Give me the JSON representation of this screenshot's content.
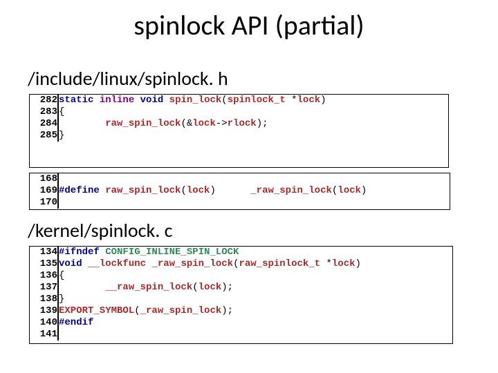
{
  "title": "spinlock API (partial)",
  "paths": {
    "header": "/include/linux/spinlock. h",
    "source": "/kernel/spinlock. c"
  },
  "block1": {
    "lines": [
      {
        "ln": "282",
        "segs": [
          {
            "c": "kw2",
            "t": "static"
          },
          {
            "c": "plain",
            "t": " "
          },
          {
            "c": "kw",
            "t": "inline"
          },
          {
            "c": "plain",
            "t": " "
          },
          {
            "c": "kw2",
            "t": "void"
          },
          {
            "c": "plain",
            "t": " "
          },
          {
            "c": "ident",
            "t": "spin_lock"
          },
          {
            "c": "plain",
            "t": "("
          },
          {
            "c": "ident",
            "t": "spinlock_t"
          },
          {
            "c": "plain",
            "t": " *"
          },
          {
            "c": "ident",
            "t": "lock"
          },
          {
            "c": "plain",
            "t": ")"
          }
        ]
      },
      {
        "ln": "283",
        "segs": [
          {
            "c": "plain",
            "t": "{"
          }
        ]
      },
      {
        "ln": "284",
        "segs": [
          {
            "c": "plain",
            "t": "        "
          },
          {
            "c": "ident",
            "t": "raw_spin_lock"
          },
          {
            "c": "plain",
            "t": "(&"
          },
          {
            "c": "ident",
            "t": "lock"
          },
          {
            "c": "plain",
            "t": "->"
          },
          {
            "c": "ident",
            "t": "rlock"
          },
          {
            "c": "plain",
            "t": ");"
          }
        ]
      },
      {
        "ln": "285",
        "segs": [
          {
            "c": "plain",
            "t": "}"
          }
        ]
      },
      {
        "ln": "",
        "segs": []
      }
    ]
  },
  "block2": {
    "lines": [
      {
        "ln": "168",
        "segs": []
      },
      {
        "ln": "169",
        "segs": [
          {
            "c": "pp",
            "t": "#define"
          },
          {
            "c": "plain",
            "t": " "
          },
          {
            "c": "ident",
            "t": "raw_spin_lock"
          },
          {
            "c": "plain",
            "t": "("
          },
          {
            "c": "ident",
            "t": "lock"
          },
          {
            "c": "plain",
            "t": ")      "
          },
          {
            "c": "ident",
            "t": "_raw_spin_lock"
          },
          {
            "c": "plain",
            "t": "("
          },
          {
            "c": "ident",
            "t": "lock"
          },
          {
            "c": "plain",
            "t": ")"
          }
        ]
      },
      {
        "ln": "170",
        "segs": []
      }
    ]
  },
  "block3": {
    "lines": [
      {
        "ln": "134",
        "segs": [
          {
            "c": "pp",
            "t": "#ifndef"
          },
          {
            "c": "plain",
            "t": " "
          },
          {
            "c": "macro",
            "t": "CONFIG_INLINE_SPIN_LOCK"
          }
        ]
      },
      {
        "ln": "135",
        "segs": [
          {
            "c": "kw2",
            "t": "void"
          },
          {
            "c": "plain",
            "t": " "
          },
          {
            "c": "ident",
            "t": "__lockfunc"
          },
          {
            "c": "plain",
            "t": " "
          },
          {
            "c": "ident",
            "t": "_raw_spin_lock"
          },
          {
            "c": "plain",
            "t": "("
          },
          {
            "c": "ident",
            "t": "raw_spinlock_t"
          },
          {
            "c": "plain",
            "t": " *"
          },
          {
            "c": "ident",
            "t": "lock"
          },
          {
            "c": "plain",
            "t": ")"
          }
        ]
      },
      {
        "ln": "136",
        "segs": [
          {
            "c": "plain",
            "t": "{"
          }
        ]
      },
      {
        "ln": "137",
        "segs": [
          {
            "c": "plain",
            "t": "        "
          },
          {
            "c": "ident",
            "t": "__raw_spin_lock"
          },
          {
            "c": "plain",
            "t": "("
          },
          {
            "c": "ident",
            "t": "lock"
          },
          {
            "c": "plain",
            "t": ");"
          }
        ]
      },
      {
        "ln": "138",
        "segs": [
          {
            "c": "plain",
            "t": "}"
          }
        ]
      },
      {
        "ln": "139",
        "segs": [
          {
            "c": "ident",
            "t": "EXPORT_SYMBOL"
          },
          {
            "c": "plain",
            "t": "("
          },
          {
            "c": "ident",
            "t": "_raw_spin_lock"
          },
          {
            "c": "plain",
            "t": ");"
          }
        ]
      },
      {
        "ln": "140",
        "segs": [
          {
            "c": "pp",
            "t": "#endif"
          }
        ]
      },
      {
        "ln": "141",
        "segs": []
      }
    ]
  }
}
